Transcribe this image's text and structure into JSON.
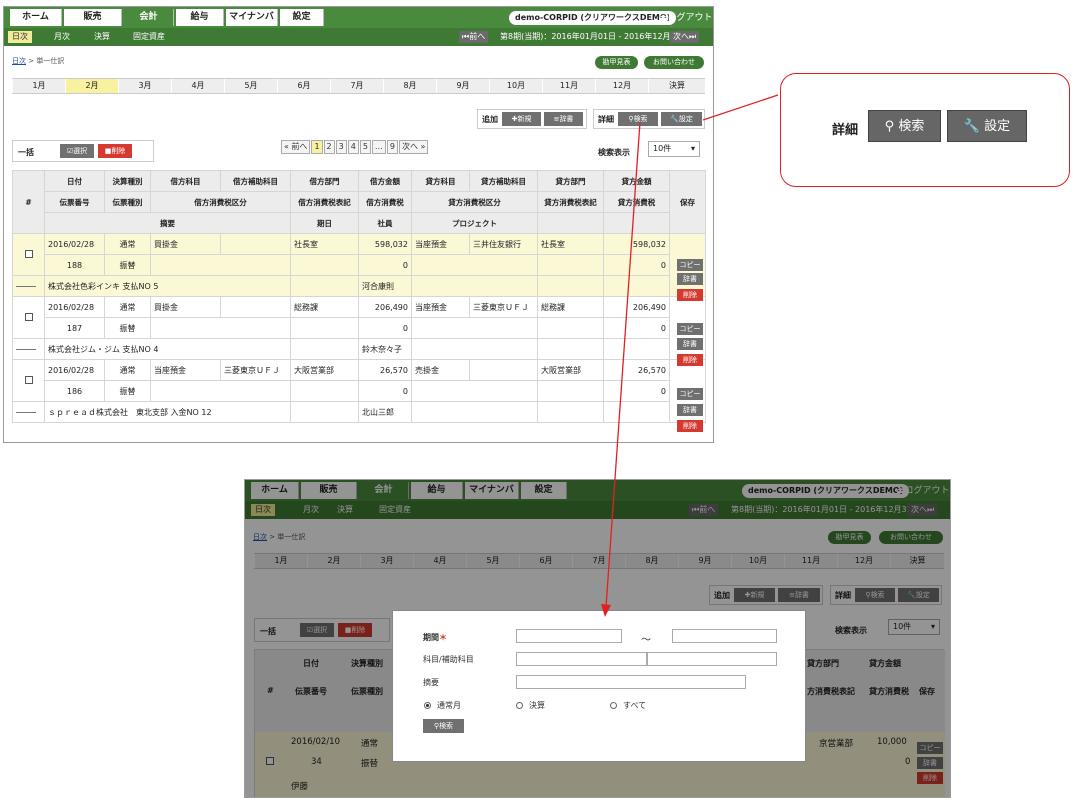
{
  "nav": {
    "tabs": [
      "ホーム",
      "販売",
      "会計",
      "給与",
      "マイナンバー",
      "設定"
    ],
    "active_index": 2,
    "company": "demo-CORPID (クリアワークスDEMO)",
    "logout": "ログアウト"
  },
  "subnav": {
    "tabs": [
      "日次",
      "月次",
      "決算",
      "固定資産"
    ],
    "active_index": 0,
    "prev": "前へ",
    "next": "次へ",
    "period": "第8期(当期)：2016年01月01日 - 2016年12月31日"
  },
  "breadcrumb": {
    "home": "日次",
    "current": "単一仕訳"
  },
  "header_buttons": {
    "shortcut": "勘甲見表",
    "contact": "お問い合わせ"
  },
  "months": [
    "1月",
    "2月",
    "3月",
    "4月",
    "5月",
    "6月",
    "7月",
    "8月",
    "9月",
    "10月",
    "11月",
    "12月",
    "決算"
  ],
  "active_month": 1,
  "add_group": {
    "label": "追加",
    "new": "新規",
    "dict": "辞書"
  },
  "detail_group": {
    "label": "詳細",
    "search": "検索",
    "settings": "設定"
  },
  "bulk": {
    "label": "一括",
    "select": "選択",
    "delete": "削除"
  },
  "pager": {
    "prev": "« 前へ",
    "pages": [
      "1",
      "2",
      "3",
      "4",
      "5",
      "…",
      "9"
    ],
    "next": "次へ »",
    "current": "1"
  },
  "display": {
    "label": "検索表示",
    "value": "10件"
  },
  "table_headers": {
    "row1": [
      "日付",
      "決算種別",
      "借方科目",
      "借方補助科目",
      "借方部門",
      "借方金額",
      "貸方科目",
      "貸方補助科目",
      "貸方部門",
      "貸方金額"
    ],
    "row2": [
      "伝票番号",
      "伝票種別",
      "借方消費税区分",
      "借方消費税表記",
      "借方消費税",
      "貸方消費税区分",
      "貸方消費税表記",
      "貸方消費税"
    ],
    "row3": [
      "摘要",
      "期日",
      "社員",
      "プロジェクト"
    ],
    "no": "#",
    "save": "保存"
  },
  "entries": [
    {
      "date": "2016/02/28",
      "settle": "通常",
      "debit_acct": "買掛金",
      "debit_sub": "",
      "debit_dept": "社長室",
      "debit_amt": "598,032",
      "credit_acct": "当座預金",
      "credit_sub": "三井住友銀行",
      "credit_dept": "社長室",
      "credit_amt": "598,032",
      "no": "188",
      "type": "振替",
      "debit_tax": "",
      "credit_tax": "0",
      "memo": "株式会社色彩インキ 支払NO 5",
      "staff": "河合康則"
    },
    {
      "date": "2016/02/28",
      "settle": "通常",
      "debit_acct": "買掛金",
      "debit_sub": "",
      "debit_dept": "総務課",
      "debit_amt": "206,490",
      "credit_acct": "当座預金",
      "credit_sub": "三菱東京ＵＦＪ",
      "credit_dept": "総務課",
      "credit_amt": "206,490",
      "no": "187",
      "type": "振替",
      "debit_tax": "0",
      "credit_tax": "0",
      "memo": "株式会社ジム・ジム 支払NO 4",
      "staff": "鈴木奈々子"
    },
    {
      "date": "2016/02/28",
      "settle": "通常",
      "debit_acct": "当座預金",
      "debit_sub": "三菱東京ＵＦＪ",
      "debit_dept": "大阪営業部",
      "debit_amt": "26,570",
      "credit_acct": "売掛金",
      "credit_sub": "",
      "credit_dept": "大阪営業部",
      "credit_amt": "26,570",
      "no": "186",
      "type": "振替",
      "debit_tax": "0",
      "credit_tax": "0",
      "memo": "ｓｐｒｅａｄ株式会社　東北支部 入金NO 12",
      "staff": "北山三郎"
    }
  ],
  "row_buttons": {
    "copy": "コピー",
    "dict": "辞書",
    "delete": "削除"
  },
  "zoom": {
    "label": "詳細",
    "search": "検索",
    "settings": "設定"
  },
  "modal": {
    "period_label": "期間",
    "required": "＊",
    "range_sep": "～",
    "account_label": "科目/補助科目",
    "memo_label": "摘要",
    "radios": [
      "通常月",
      "決算",
      "すべて"
    ],
    "radio_selected": 0,
    "search_button": "検索"
  },
  "shot2_entry": {
    "date": "2016/02/10",
    "settle": "通常",
    "no": "34",
    "type": "振替",
    "memo": "伊藤",
    "credit_dept_partial": "京営業部",
    "credit_amt": "10,000",
    "credit_tax": "0"
  },
  "shot2_partial": {
    "credit_dept_header": "貸方部門",
    "credit_tax_label_header": "方消費税表記"
  },
  "colors": {
    "brand_green": "#4a8a3e",
    "highlight": "#f7f1a0",
    "delete_red": "#d43a2f",
    "callout_red": "#e32020"
  }
}
